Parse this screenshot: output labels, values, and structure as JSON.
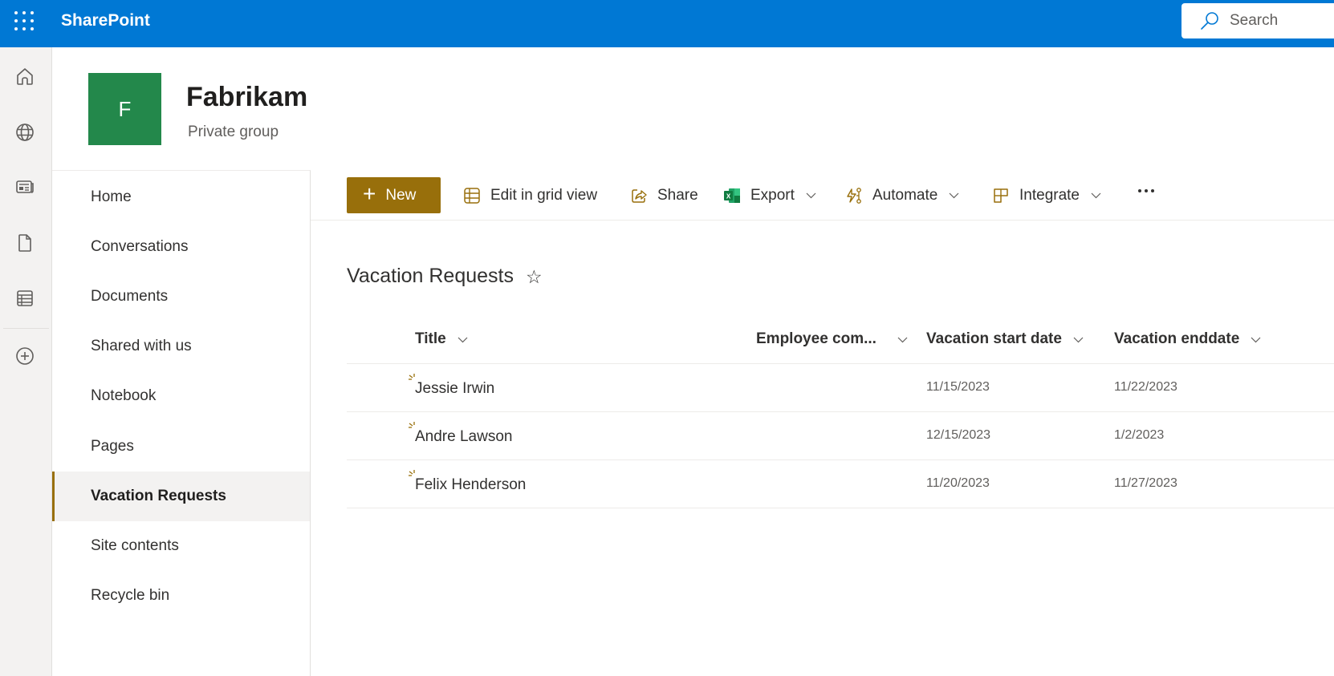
{
  "topbar": {
    "app_name": "SharePoint",
    "search_placeholder": "Search",
    "brand_color": "#0078d4"
  },
  "app_rail": {
    "items": [
      "home",
      "global-sites",
      "news",
      "files",
      "lists",
      "create"
    ]
  },
  "site": {
    "logo_letter": "F",
    "logo_color": "#23884b",
    "title": "Fabrikam",
    "subtitle": "Private group"
  },
  "left_nav": {
    "items": [
      {
        "label": "Home",
        "active": false
      },
      {
        "label": "Conversations",
        "active": false
      },
      {
        "label": "Documents",
        "active": false
      },
      {
        "label": "Shared with us",
        "active": false
      },
      {
        "label": "Notebook",
        "active": false
      },
      {
        "label": "Pages",
        "active": false
      },
      {
        "label": "Vacation Requests",
        "active": true
      },
      {
        "label": "Site contents",
        "active": false
      },
      {
        "label": "Recycle bin",
        "active": false
      }
    ]
  },
  "command_bar": {
    "new_label": "New",
    "edit_grid_label": "Edit in grid view",
    "share_label": "Share",
    "export_label": "Export",
    "automate_label": "Automate",
    "integrate_label": "Integrate",
    "accent_color": "#986f0b"
  },
  "list": {
    "title": "Vacation Requests",
    "columns": [
      "Title",
      "Employee com...",
      "Vacation start date",
      "Vacation enddate"
    ],
    "rows": [
      {
        "title": "Jessie Irwin",
        "employee_comments": "",
        "start": "11/15/2023",
        "end": "11/22/2023",
        "is_new": true
      },
      {
        "title": "Andre Lawson",
        "employee_comments": "",
        "start": "12/15/2023",
        "end": "1/2/2023",
        "is_new": true
      },
      {
        "title": "Felix Henderson",
        "employee_comments": "",
        "start": "11/20/2023",
        "end": "11/27/2023",
        "is_new": true
      }
    ]
  }
}
